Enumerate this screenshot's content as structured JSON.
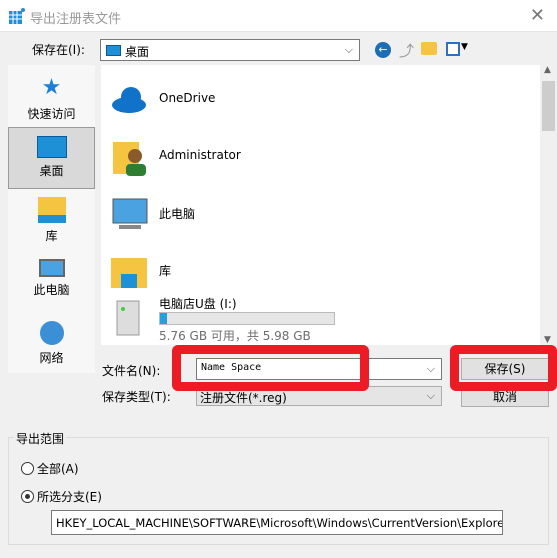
{
  "window": {
    "title": "导出注册表文件",
    "close_icon": "close-icon"
  },
  "toolbar": {
    "save_in_label": "保存在(I):",
    "location": "桌面"
  },
  "sidebar": {
    "items": [
      {
        "label": "快速访问",
        "icon": "star-icon"
      },
      {
        "label": "桌面",
        "icon": "desktop-icon",
        "selected": true
      },
      {
        "label": "库",
        "icon": "library-icon"
      },
      {
        "label": "此电脑",
        "icon": "computer-icon"
      },
      {
        "label": "网络",
        "icon": "network-icon"
      }
    ]
  },
  "files": [
    {
      "name": "OneDrive",
      "icon": "cloud-icon"
    },
    {
      "name": "Administrator",
      "icon": "user-folder-icon"
    },
    {
      "name": "此电脑",
      "icon": "computer-icon"
    },
    {
      "name": "库",
      "icon": "library-icon"
    },
    {
      "name": "电脑店U盘 (I:)",
      "icon": "drive-icon",
      "usage_percent": 4,
      "space": "5.76 GB 可用，共 5.98 GB"
    }
  ],
  "form": {
    "filename_label": "文件名(N):",
    "filename": "Name Space",
    "filetype_label": "保存类型(T):",
    "filetype": "注册文件(*.reg)",
    "save_label": "保存(S)",
    "cancel_label": "取消"
  },
  "export": {
    "group_label": "导出范围",
    "all_label": "全部(A)",
    "branch_label": "所选分支(E)",
    "selected": "branch",
    "branch_path": "HKEY_LOCAL_MACHINE\\SOFTWARE\\Microsoft\\Windows\\CurrentVersion\\Explorer\\"
  },
  "colors": {
    "highlight": "#ed1c24",
    "accent": "#26a0da"
  }
}
